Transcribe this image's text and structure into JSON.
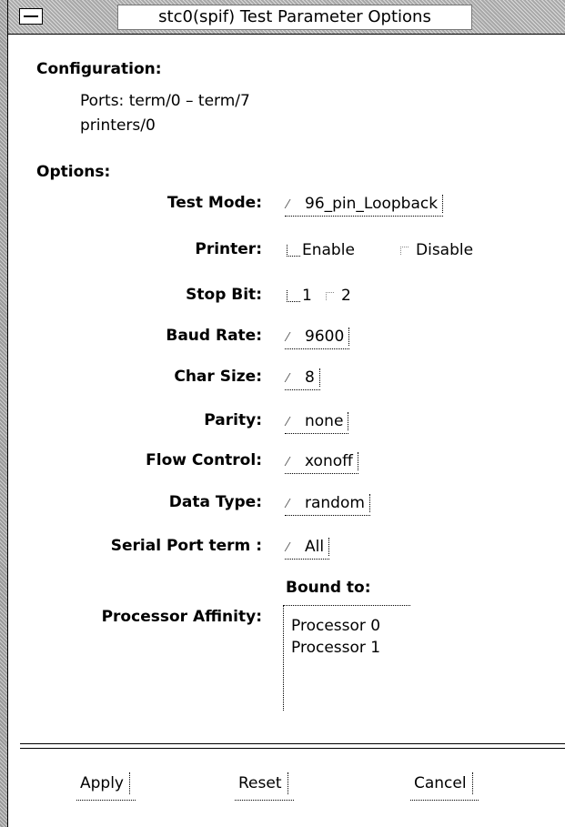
{
  "window": {
    "title": "stc0(spif) Test Parameter Options"
  },
  "configuration": {
    "heading": "Configuration:",
    "ports_line": "Ports: term/0 – term/7",
    "printers_line": "printers/0"
  },
  "options": {
    "heading": "Options:",
    "test_mode": {
      "label": "Test Mode:",
      "value": "96_pin_Loopback"
    },
    "printer": {
      "label": "Printer:",
      "options": [
        "Enable",
        "Disable"
      ],
      "selected": "Enable"
    },
    "stop_bit": {
      "label": "Stop Bit:",
      "options": [
        "1",
        "2"
      ],
      "selected": "1"
    },
    "baud_rate": {
      "label": "Baud Rate:",
      "value": "9600"
    },
    "char_size": {
      "label": "Char Size:",
      "value": "8"
    },
    "parity": {
      "label": "Parity:",
      "value": "none"
    },
    "flow_control": {
      "label": "Flow Control:",
      "value": "xonoff"
    },
    "data_type": {
      "label": "Data Type:",
      "value": "random"
    },
    "serial_port": {
      "label": "Serial Port term :",
      "value": "All"
    },
    "processor_affinity": {
      "label": "Processor Affinity:",
      "bound_heading": "Bound to:",
      "items": [
        "Processor 0",
        "Processor 1"
      ]
    }
  },
  "buttons": {
    "apply": "Apply",
    "reset": "Reset",
    "cancel": "Cancel"
  }
}
